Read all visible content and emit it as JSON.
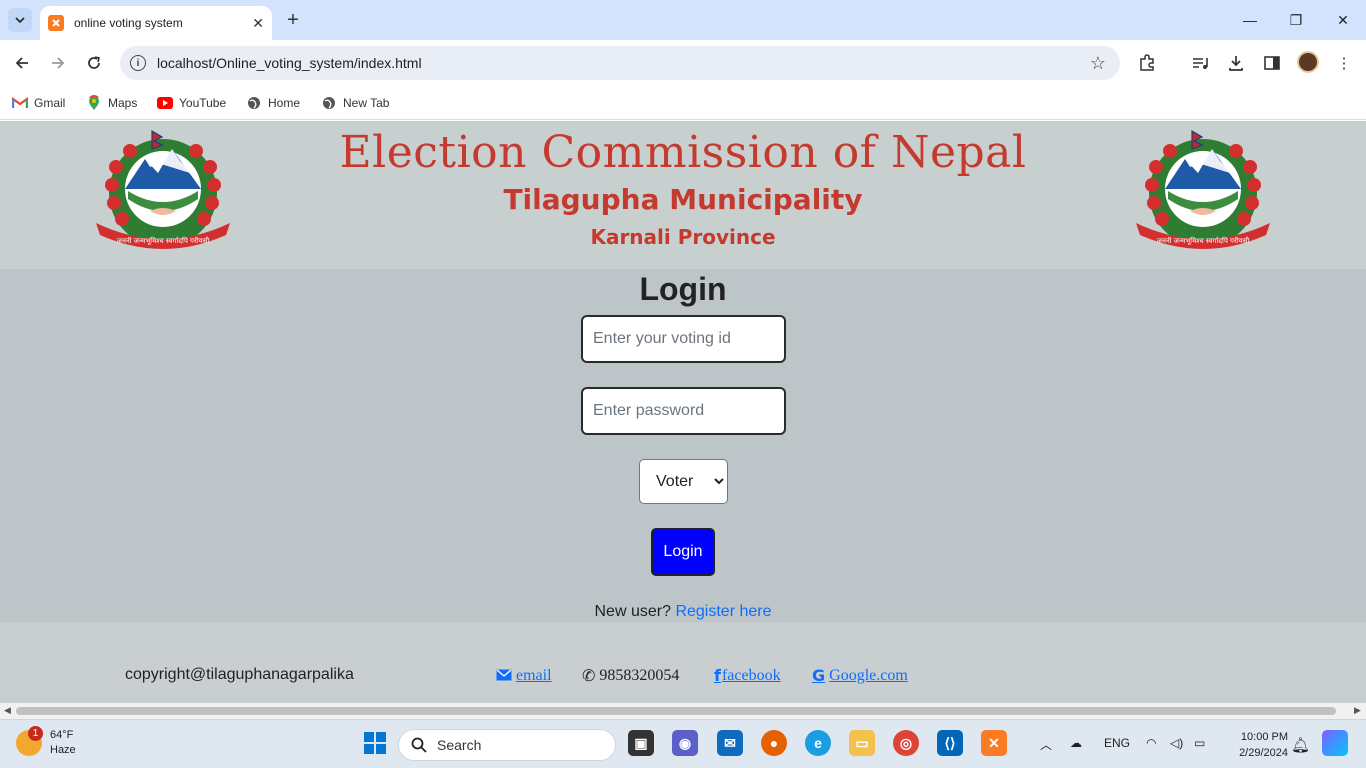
{
  "browser": {
    "tab_title": "online voting system",
    "url": "localhost/Online_voting_system/index.html",
    "bookmarks": [
      {
        "label": "Gmail",
        "icon": "gmail-icon"
      },
      {
        "label": "Maps",
        "icon": "maps-icon"
      },
      {
        "label": "YouTube",
        "icon": "youtube-icon"
      },
      {
        "label": "Home",
        "icon": "globe-icon"
      },
      {
        "label": "New Tab",
        "icon": "globe-icon"
      }
    ]
  },
  "header": {
    "title": "Election Commission of Nepal",
    "municipality": "Tilagupha Municipality",
    "province": "Karnali Province",
    "emblem_icon": "nepal-emblem-icon",
    "emblem_motto": "जननी जन्मभूमिश्च स्वर्गादपि गरीयसी"
  },
  "login": {
    "heading": "Login",
    "voting_id_placeholder": "Enter your voting id",
    "password_placeholder": "Enter password",
    "role_selected": "Voter",
    "button_label": "Login",
    "new_user_text": "New user?",
    "register_link": "Register here"
  },
  "footer": {
    "copyright": "copyright@tilaguphanagarpalika",
    "email_label": "email",
    "phone": "9858320054",
    "facebook_label": "facebook",
    "google_label": "Google.com"
  },
  "taskbar": {
    "weather_temp": "64°F",
    "weather_desc": "Haze",
    "weather_badge": "1",
    "search_label": "Search",
    "language": "ENG",
    "time": "10:00 PM",
    "date": "2/29/2024"
  },
  "colors": {
    "header_text": "#c43a2e",
    "login_button": "#0000ff",
    "link": "#0d6efd",
    "page_background": "#bec5c8"
  }
}
